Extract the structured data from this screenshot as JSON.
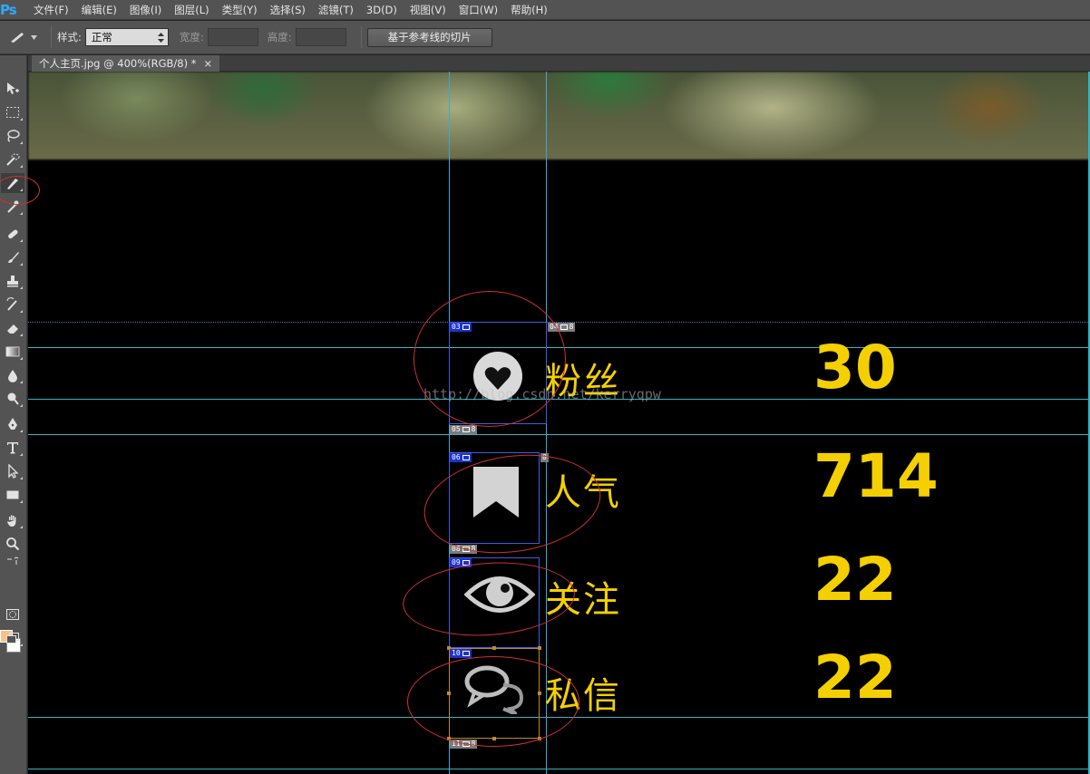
{
  "app": {
    "logo": "Ps"
  },
  "menu": [
    "文件(F)",
    "编辑(E)",
    "图像(I)",
    "图层(L)",
    "类型(Y)",
    "选择(S)",
    "滤镜(T)",
    "3D(D)",
    "视图(V)",
    "窗口(W)",
    "帮助(H)"
  ],
  "options": {
    "style_label": "样式:",
    "style_value": "正常",
    "width_label": "宽度:",
    "height_label": "高度:",
    "slice_button": "基于参考线的切片"
  },
  "document": {
    "tab_title": "个人主页.jpg @ 400%(RGB/8) *",
    "close": "×"
  },
  "colors": {
    "foreground": "#f9c08b",
    "background": "#ffffff",
    "accent_text": "#f4d000"
  },
  "slices": [
    {
      "id": "03"
    },
    {
      "id": "04"
    },
    {
      "id": "05"
    },
    {
      "id": "06"
    },
    {
      "id": "0"
    },
    {
      "id": "08"
    },
    {
      "id": "09"
    },
    {
      "id": "10"
    },
    {
      "id": "11"
    }
  ],
  "stats": [
    {
      "label": "粉丝",
      "value": "30",
      "icon": "heart-icon"
    },
    {
      "label": "人气",
      "value": "714",
      "icon": "bookmark-icon"
    },
    {
      "label": "关注",
      "value": "22",
      "icon": "eye-icon"
    },
    {
      "label": "私信",
      "value": "22",
      "icon": "chat-bubbles-icon"
    }
  ],
  "watermark": "http://blog.csdn.net/kerryqpw"
}
